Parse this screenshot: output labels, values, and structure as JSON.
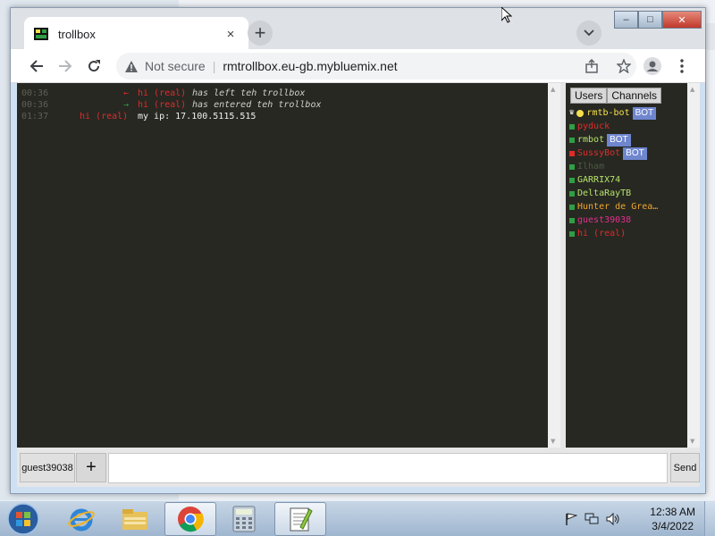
{
  "browser": {
    "tab_title": "trollbox",
    "tab_close": "×",
    "new_tab": "+",
    "not_secure": "Not secure",
    "url": "rmtrollbox.eu-gb.mybluemix.net",
    "window_controls": {
      "minimize": "–",
      "maximize": "□",
      "close": "✕"
    }
  },
  "chat": {
    "messages": [
      {
        "time": "00:36",
        "arrow": "←",
        "nick": "hi (real)",
        "text": "has left teh trollbox",
        "kind": "leave"
      },
      {
        "time": "00:36",
        "arrow": "→",
        "nick": "hi (real)",
        "text": "has entered teh trollbox",
        "kind": "enter"
      },
      {
        "time": "01:37",
        "arrow": "",
        "nick": "hi (real)",
        "text": "my ip: 17.100.5115.515",
        "kind": "message"
      }
    ]
  },
  "users_panel": {
    "tabs": [
      "Users",
      "Channels"
    ],
    "bot_badge": "BOT",
    "users": [
      {
        "name": "rmtb-bot",
        "color": "#f4e04d",
        "status": "#f4e04d",
        "crown": "♛",
        "bot": true
      },
      {
        "name": "pyduck",
        "color": "#e02b2b",
        "status": "#2f9e44",
        "bot": false
      },
      {
        "name": "rmbot",
        "color": "#b6e36a",
        "status": "#2f9e44",
        "bot": true
      },
      {
        "name": "SussyBot",
        "color": "#e02b2b",
        "status": "#e02b2b",
        "bot": true
      },
      {
        "name": "Ilham",
        "color": "#4a5a44",
        "status": "#2f9e44",
        "bot": false
      },
      {
        "name": "GARRIX74",
        "color": "#b6e36a",
        "status": "#2f9e44",
        "bot": false
      },
      {
        "name": "DeltaRayTB",
        "color": "#b6e36a",
        "status": "#2f9e44",
        "bot": false
      },
      {
        "name": "Hunter de Grea…",
        "color": "#f0a62b",
        "status": "#2f9e44",
        "bot": false
      },
      {
        "name": "guest39038",
        "color": "#e0318c",
        "status": "#2f9e44",
        "bot": false
      },
      {
        "name": "hi (real)",
        "color": "#e02b2b",
        "status": "#2f9e44",
        "bot": false
      }
    ]
  },
  "input_bar": {
    "nick_label": "guest39038",
    "add_label": "+",
    "send_label": "Send"
  },
  "taskbar": {
    "time": "12:38 AM",
    "date": "3/4/2022"
  }
}
